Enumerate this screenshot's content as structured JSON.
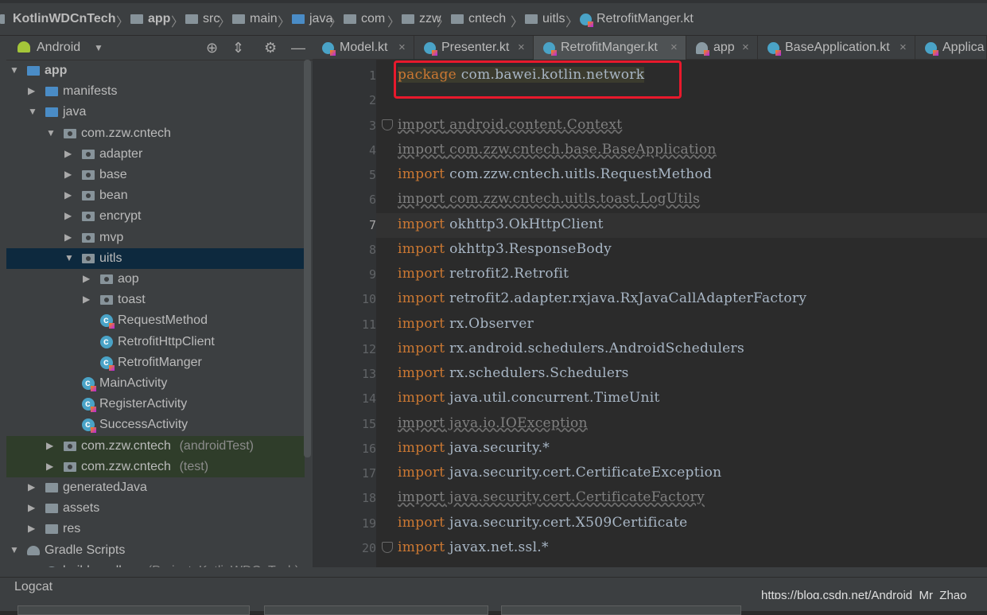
{
  "breadcrumb": {
    "items": [
      {
        "label": "KotlinWDCnTech",
        "icon": "project-icon"
      },
      {
        "label": "app",
        "icon": "module-folder-icon"
      },
      {
        "label": "src",
        "icon": "folder-icon"
      },
      {
        "label": "main",
        "icon": "folder-icon"
      },
      {
        "label": "java",
        "icon": "folder-icon"
      },
      {
        "label": "com",
        "icon": "package-icon"
      },
      {
        "label": "zzw",
        "icon": "package-icon"
      },
      {
        "label": "cntech",
        "icon": "package-icon"
      },
      {
        "label": "uitls",
        "icon": "package-icon"
      },
      {
        "label": "RetrofitManger.kt",
        "icon": "kotlin-file-icon"
      }
    ]
  },
  "project_panel": {
    "view": "Android",
    "tree": [
      {
        "label": "app",
        "icon": "module-folder-icon",
        "expanded": true
      },
      {
        "label": "manifests",
        "icon": "folder-icon",
        "expanded": false
      },
      {
        "label": "java",
        "icon": "folder-icon",
        "expanded": true
      },
      {
        "label": "com.zzw.cntech",
        "icon": "package-icon",
        "expanded": true
      },
      {
        "label": "adapter",
        "icon": "package-icon",
        "expanded": false
      },
      {
        "label": "base",
        "icon": "package-icon",
        "expanded": false
      },
      {
        "label": "bean",
        "icon": "package-icon",
        "expanded": false
      },
      {
        "label": "encrypt",
        "icon": "package-icon",
        "expanded": false
      },
      {
        "label": "mvp",
        "icon": "package-icon",
        "expanded": false
      },
      {
        "label": "uitls",
        "icon": "package-icon",
        "expanded": true,
        "selected": true
      },
      {
        "label": "aop",
        "icon": "package-icon",
        "expanded": false
      },
      {
        "label": "toast",
        "icon": "package-icon",
        "expanded": false
      },
      {
        "label": "RequestMethod",
        "icon": "kotlin-class-icon"
      },
      {
        "label": "RetrofitHttpClient",
        "icon": "java-class-icon"
      },
      {
        "label": "RetrofitManger",
        "icon": "kotlin-class-icon"
      },
      {
        "label": "MainActivity",
        "icon": "kotlin-class-icon"
      },
      {
        "label": "RegisterActivity",
        "icon": "kotlin-class-icon"
      },
      {
        "label": "SuccessActivity",
        "icon": "kotlin-class-icon"
      },
      {
        "label": "com.zzw.cntech",
        "suffix": "(androidTest)",
        "icon": "package-icon",
        "expanded": false
      },
      {
        "label": "com.zzw.cntech",
        "suffix": "(test)",
        "icon": "package-icon",
        "expanded": false
      },
      {
        "label": "generatedJava",
        "icon": "generated-folder-icon",
        "expanded": false
      },
      {
        "label": "assets",
        "icon": "assets-folder-icon",
        "expanded": false
      },
      {
        "label": "res",
        "icon": "res-folder-icon",
        "expanded": false
      },
      {
        "label": "Gradle Scripts",
        "icon": "gradle-icon",
        "expanded": true
      },
      {
        "label": "build.gradle",
        "suffix": "(Project: KotlinWDCnTech)",
        "icon": "gradle-file-icon"
      }
    ]
  },
  "tabs": [
    {
      "label": "Model.kt",
      "active": false
    },
    {
      "label": "Presenter.kt",
      "active": false
    },
    {
      "label": "RetrofitManger.kt",
      "active": true
    },
    {
      "label": "app",
      "active": false
    },
    {
      "label": "BaseApplication.kt",
      "active": false
    },
    {
      "label": "Applica",
      "active": false
    }
  ],
  "editor": {
    "current_line": 7,
    "lines": [
      {
        "n": "1",
        "kw": "package",
        "rest": " com.bawei.kotlin.network",
        "unused": false
      },
      {
        "n": "2",
        "kw": "",
        "rest": "",
        "unused": false
      },
      {
        "n": "3",
        "kw": "import",
        "rest": " android.content.Context",
        "unused": true
      },
      {
        "n": "4",
        "kw": "import",
        "rest": " com.zzw.cntech.base.BaseApplication",
        "unused": true
      },
      {
        "n": "5",
        "kw": "import",
        "rest": " com.zzw.cntech.uitls.RequestMethod",
        "unused": false
      },
      {
        "n": "6",
        "kw": "import",
        "rest": " com.zzw.cntech.uitls.toast.LogUtils",
        "unused": true
      },
      {
        "n": "7",
        "kw": "import",
        "rest": " okhttp3.OkHttpClient",
        "unused": false
      },
      {
        "n": "8",
        "kw": "import",
        "rest": " okhttp3.ResponseBody",
        "unused": false
      },
      {
        "n": "9",
        "kw": "import",
        "rest": " retrofit2.Retrofit",
        "unused": false
      },
      {
        "n": "10",
        "kw": "import",
        "rest": " retrofit2.adapter.rxjava.RxJavaCallAdapterFactory",
        "unused": false
      },
      {
        "n": "11",
        "kw": "import",
        "rest": " rx.Observer",
        "unused": false
      },
      {
        "n": "12",
        "kw": "import",
        "rest": " rx.android.schedulers.AndroidSchedulers",
        "unused": false
      },
      {
        "n": "13",
        "kw": "import",
        "rest": " rx.schedulers.Schedulers",
        "unused": false
      },
      {
        "n": "14",
        "kw": "import",
        "rest": " java.util.concurrent.TimeUnit",
        "unused": false
      },
      {
        "n": "15",
        "kw": "import",
        "rest": " java.io.IOException",
        "unused": true
      },
      {
        "n": "16",
        "kw": "import",
        "rest": " java.security.*",
        "unused": false
      },
      {
        "n": "17",
        "kw": "import",
        "rest": " java.security.cert.CertificateException",
        "unused": false
      },
      {
        "n": "18",
        "kw": "import",
        "rest": " java.security.cert.CertificateFactory",
        "unused": true
      },
      {
        "n": "19",
        "kw": "import",
        "rest": " java.security.cert.X509Certificate",
        "unused": false
      },
      {
        "n": "20",
        "kw": "import",
        "rest": " javax.net.ssl.*",
        "unused": false
      }
    ]
  },
  "bottom": {
    "logcat_label": "Logcat",
    "watermark": "https://blog.csdn.net/Android_Mr_Zhao"
  },
  "colors": {
    "keyword": "#cc7832",
    "text": "#a9b7c6",
    "unused": "#808080",
    "highlight_box": "#e8192c",
    "selection": "#0d293e"
  }
}
